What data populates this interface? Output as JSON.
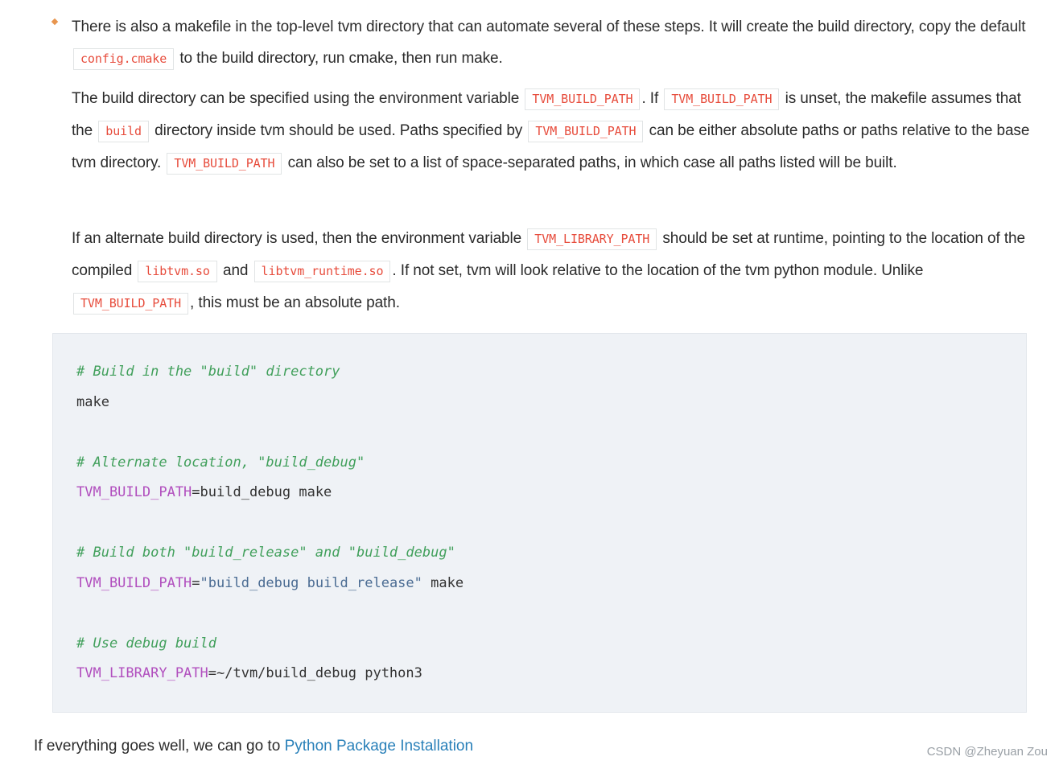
{
  "bullet": {
    "p1": {
      "a": "There is also a makefile in the top-level tvm directory that can automate several of these steps. It will create the build directory, copy the default ",
      "code1": "config.cmake",
      "b": " to the build directory, run cmake, then run make."
    },
    "p2": {
      "a": "The build directory can be specified using the environment variable ",
      "code1": "TVM_BUILD_PATH",
      "b": ". If ",
      "code2": "TVM_BUILD_PATH",
      "c": " is unset, the makefile assumes that the ",
      "code3": "build",
      "d": " directory inside tvm should be used. Paths specified by ",
      "code4": "TVM_BUILD_PATH",
      "e": " can be either absolute paths or paths relative to the base tvm directory. ",
      "code5": "TVM_BUILD_PATH",
      "f": " can also be set to a list of space-separated paths, in which case all paths listed will be built."
    },
    "p3": {
      "a": "If an alternate build directory is used, then the environment variable ",
      "code1": "TVM_LIBRARY_PATH",
      "b": " should be set at runtime, pointing to the location of the compiled ",
      "code2": "libtvm.so",
      "c": " and ",
      "code3": "libtvm_runtime.so",
      "d": ". If not set, tvm will look relative to the location of the tvm python module. Unlike ",
      "code4": "TVM_BUILD_PATH",
      "e": ", this must be an absolute path."
    }
  },
  "code_block": {
    "c1": "# Build in the \"build\" directory",
    "l1": "make",
    "c2": "# Alternate location, \"build_debug\"",
    "l2_var": "TVM_BUILD_PATH",
    "l2_rest": "=build_debug make",
    "c3": "# Build both \"build_release\" and \"build_debug\"",
    "l3_var": "TVM_BUILD_PATH",
    "l3_eq": "=",
    "l3_str": "\"build_debug build_release\"",
    "l3_rest": " make",
    "c4": "# Use debug build",
    "l4_var": "TVM_LIBRARY_PATH",
    "l4_rest": "=~/tvm/build_debug python3"
  },
  "footer": {
    "text": "If everything goes well, we can go to ",
    "link": "Python Package Installation"
  },
  "watermark": "CSDN @Zheyuan Zou",
  "colors": {
    "inline_code_text": "#e74c3c",
    "code_bg": "#eff2f6",
    "comment": "#42a05c",
    "variable": "#b14fbe",
    "string": "#4b6c93",
    "link": "#2980b9",
    "bullet": "#e8954e"
  }
}
